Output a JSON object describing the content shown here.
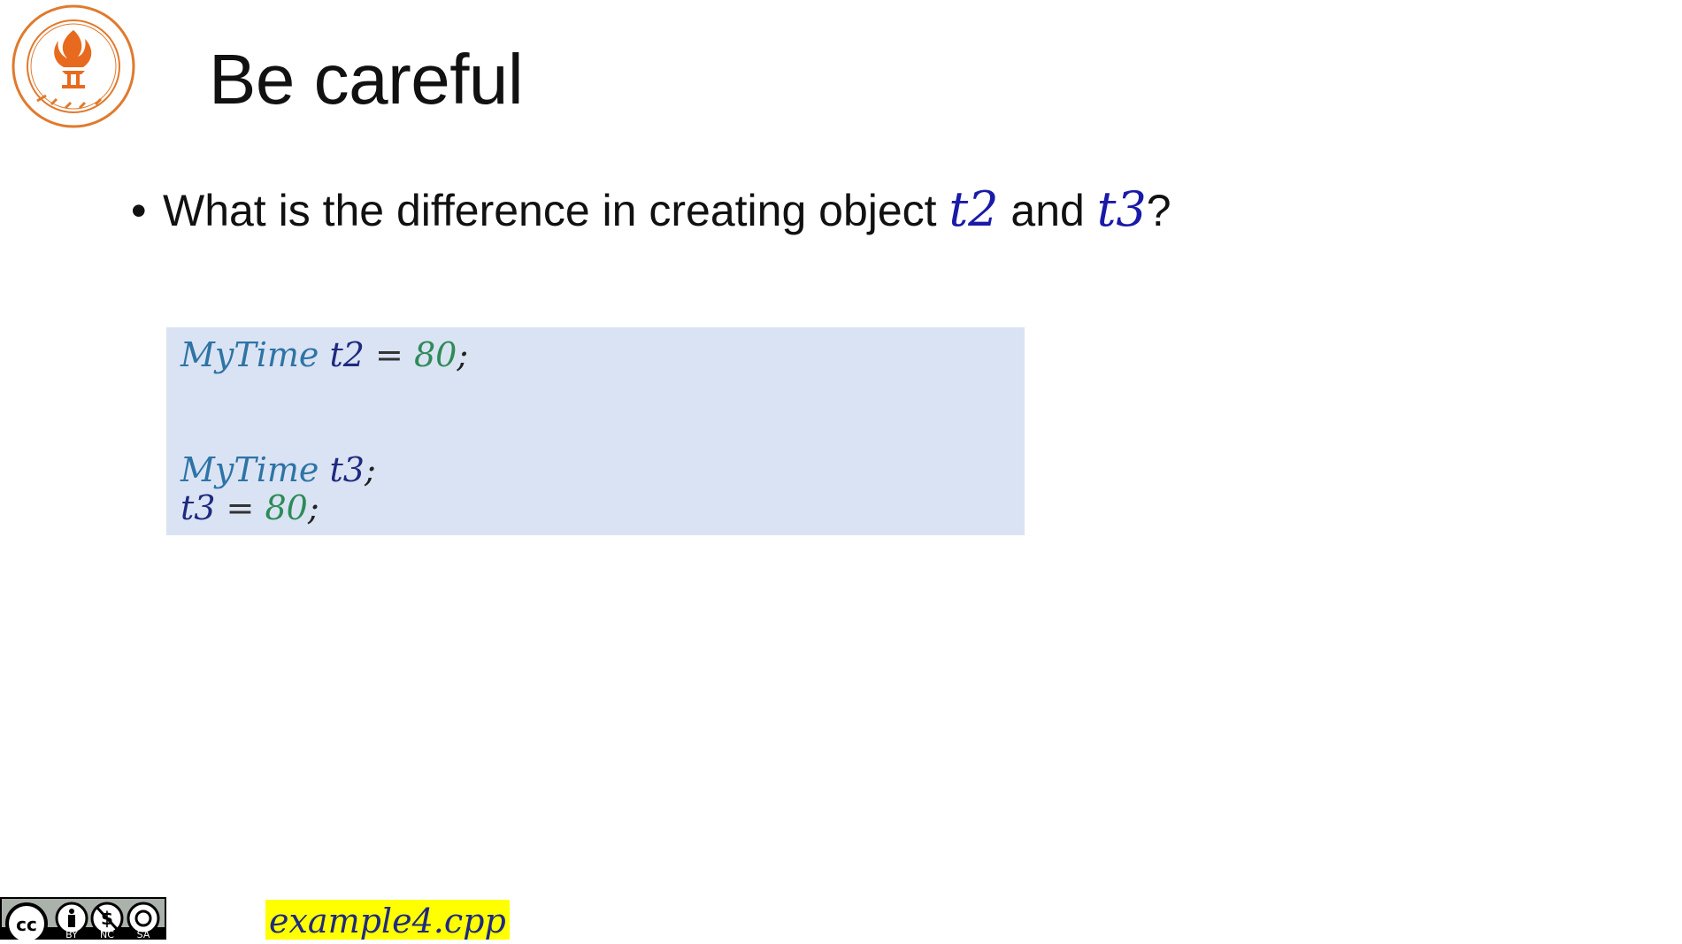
{
  "slide": {
    "title": "Be careful",
    "bullet": {
      "text_before": "What is the difference in creating object ",
      "var1": "t2",
      "text_middle": " and ",
      "var2": "t3",
      "text_after": "?"
    }
  },
  "code": {
    "line1": {
      "type": "MyTime",
      "var": "t2",
      "op": "=",
      "num": "80",
      "end": ";"
    },
    "line2": {
      "type": "MyTime",
      "var": "t3",
      "end": ";"
    },
    "line3": {
      "var": "t3",
      "op": "=",
      "num": "80",
      "end": ";"
    }
  },
  "footer": {
    "license_labels": [
      "BY",
      "NC",
      "SA"
    ],
    "filename": "example4.cpp"
  },
  "icons": {
    "logo": "university-seal-icon",
    "license": "creative-commons-icon"
  },
  "colors": {
    "var_blue": "#1a1aa8",
    "code_bg": "#dae3f3",
    "type_color": "#2e74a6",
    "num_color": "#2e8b57",
    "highlight": "#ffff00",
    "seal_orange": "#e86a1e"
  }
}
